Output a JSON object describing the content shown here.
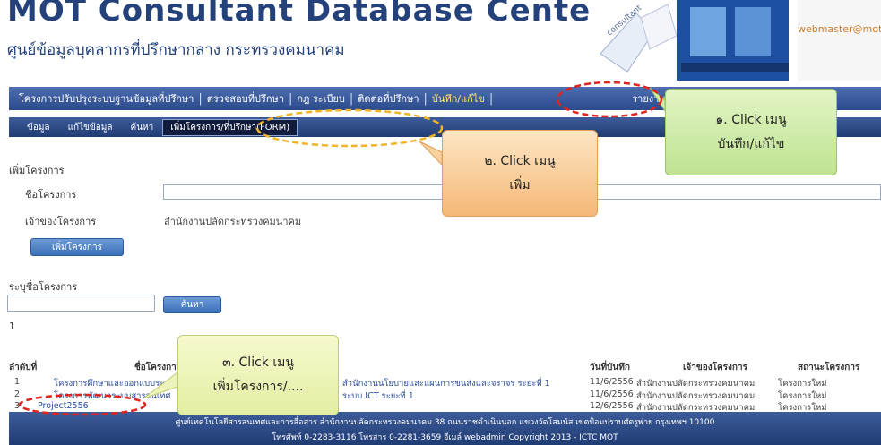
{
  "header": {
    "title_en": "MOT Consultant Database Center",
    "title_th": "ศูนย์ข้อมูลบุคลากรที่ปรึกษากลาง กระทรวงคมนาคม",
    "right_text_1": "",
    "right_text_2": "webmaster@mot"
  },
  "main_nav": {
    "items": [
      {
        "label": "โครงการปรับปรุงระบบฐานข้อมูลที่ปรึกษา"
      },
      {
        "label": "ตรวจสอบที่ปรึกษา"
      },
      {
        "label": "กฎ ระเบียบ"
      },
      {
        "label": "ติดต่อที่ปรึกษา"
      },
      {
        "label": "บันทึก/แก้ไข"
      },
      {
        "label": "รายงาน"
      }
    ]
  },
  "sub_nav": {
    "items": [
      {
        "label": "ข้อมูล"
      },
      {
        "label": "แก้ไขข้อมูล"
      },
      {
        "label": "ค้นหา"
      },
      {
        "label": "เพิ่มโครงการ/ที่ปรึกษา(FORM)"
      }
    ]
  },
  "form": {
    "section_title": "เพิ่มโครงการ",
    "project_name_label": "ชื่อโครงการ",
    "project_name_value": "",
    "owner_label": "เจ้าของโครงการ",
    "owner_value": "สำนักงานปลัดกระทรวงคมนาคม",
    "add_button": "เพิ่มโครงการ"
  },
  "search": {
    "label": "ระบุชื่อโครงการ",
    "value": "",
    "button": "ค้นหา"
  },
  "table": {
    "count": "1",
    "headers": [
      "ลำดับที่",
      "ชื่อโครงการ",
      "วันที่บันทึก",
      "เจ้าของโครงการ",
      "สถานะโครงการ"
    ],
    "rows": [
      {
        "no": "1",
        "name": "โครงการศึกษาและออกแบบระบบข้อมูล",
        "extra": "สำนักงานนโยบายและแผนการขนส่งและจราจร ระยะที่ 1",
        "date": "11/6/2556",
        "owner": "สำนักงานปลัดกระทรวงคมนาคม",
        "status": "โครงการใหม่"
      },
      {
        "no": "2",
        "name": "โครงการพัฒนาระบบสารสนเทศ",
        "extra": "ระบบ ICT ระยะที่ 1",
        "date": "11/6/2556",
        "owner": "สำนักงานปลัดกระทรวงคมนาคม",
        "status": "โครงการใหม่"
      },
      {
        "no": "3",
        "name": "Project2556",
        "extra": "",
        "date": "12/6/2556",
        "owner": "สำนักงานปลัดกระทรวงคมนาคม",
        "status": "โครงการใหม่"
      }
    ]
  },
  "footer": {
    "line1": "ศูนย์เทคโนโลยีสารสนเทศและการสื่อสาร สำนักงานปลัดกระทรวงคมนาคม 38 ถนนราชดำเนินนอก แขวงวัดโสมนัส เขตป้อมปราบศัตรูพ่าย กรุงเทพฯ 10100",
    "line2": "โทรศัพท์ 0-2283-3116  โทรสาร 0-2281-3659  อีเมล์ webadmin  Copyright 2013 - ICTC MOT"
  },
  "callouts": {
    "c1_line1": "๑.  Click เมนู",
    "c1_line2": "บันทึก/แก้ไข",
    "c2_line1": "๒. Click เมนู",
    "c2_line2": "เพิ่ม",
    "c3_line1": "๓. Click เมนู",
    "c3_line2": "เพิ่มโครงการ/...."
  },
  "colors": {
    "nav_blue": "#2b4a8c",
    "title_blue": "#24417a",
    "highlight_red": "#e0241e",
    "highlight_yellow": "#f0b429"
  }
}
